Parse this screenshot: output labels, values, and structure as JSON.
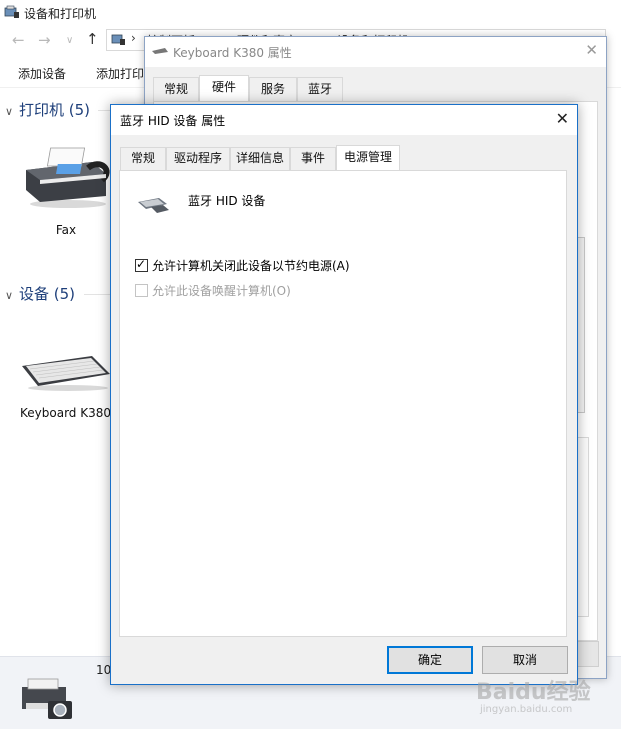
{
  "explorer": {
    "title": "设备和打印机",
    "address_segments": [
      "控制面板",
      "硬件和声音",
      "设备和打印机"
    ],
    "commands": [
      "添加设备",
      "添加打印"
    ],
    "groups": [
      {
        "label": "打印机 (5)",
        "devices": [
          "Fax"
        ]
      },
      {
        "label": "设备 (5)",
        "devices": [
          "Keyboard K380"
        ]
      }
    ],
    "bottom_count": "10"
  },
  "back_dialog": {
    "title": "Keyboard K380 属性",
    "tabs": [
      "常规",
      "硬件",
      "服务",
      "蓝牙"
    ],
    "active_tab": "硬件"
  },
  "dialog": {
    "title": "蓝牙 HID 设备 属性",
    "tabs": [
      "常规",
      "驱动程序",
      "详细信息",
      "事件",
      "电源管理"
    ],
    "active_tab": "电源管理",
    "device_name": "蓝牙 HID 设备",
    "options": [
      {
        "label": "允许计算机关闭此设备以节约电源(A)",
        "checked": true,
        "enabled": true
      },
      {
        "label": "允许此设备唤醒计算机(O)",
        "checked": false,
        "enabled": false
      }
    ],
    "ok_label": "确定",
    "cancel_label": "取消"
  },
  "watermark": {
    "text": "Baidu经验",
    "sub": "jingyan.baidu.com"
  }
}
